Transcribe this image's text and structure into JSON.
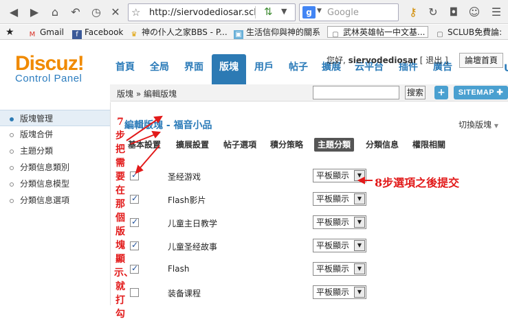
{
  "browser": {
    "url": "http://siervodediosar.sclub",
    "search_placeholder": "Google",
    "bookmarks": [
      {
        "label": "Gmail"
      },
      {
        "label": "Facebook"
      },
      {
        "label": "神の仆人之家BBS - P..."
      },
      {
        "label": "生活信仰與神的關系"
      },
      {
        "label": "武林英雄帖一中文基..."
      },
      {
        "label": "SCLUB免費論:"
      }
    ]
  },
  "header": {
    "logo_main": "Discuz!",
    "logo_sub": "Control Panel",
    "nav": [
      {
        "label": "首頁"
      },
      {
        "label": "全局"
      },
      {
        "label": "界面"
      },
      {
        "label": "版塊"
      },
      {
        "label": "用戶"
      },
      {
        "label": "帖子"
      },
      {
        "label": "擴展"
      },
      {
        "label": "云平台"
      },
      {
        "label": "插件"
      },
      {
        "label": "廣告"
      }
    ],
    "nav_cut_letter": "U",
    "user_greeting": "您好,",
    "username": "siervodediosar",
    "logout": "[ 退出 ]",
    "home_button": "論壇首頁"
  },
  "subbar": {
    "breadcrumb": "版塊 » 編輯版塊",
    "search_button": "搜索",
    "plus_label": "+",
    "sitemap_label": "SITEMAP"
  },
  "sidebar": {
    "items": [
      {
        "label": "版塊管理"
      },
      {
        "label": "版塊合併"
      },
      {
        "label": "主題分類"
      },
      {
        "label": "分類信息類別"
      },
      {
        "label": "分類信息模型"
      },
      {
        "label": "分類信息選項"
      }
    ]
  },
  "main": {
    "heading_prefix": "編輯版塊",
    "heading_sep": " - ",
    "heading_board": "福音小品",
    "switch_board": "切換版塊",
    "tabs": [
      {
        "label": "基本設置"
      },
      {
        "label": "擴展設置"
      },
      {
        "label": "帖子選項"
      },
      {
        "label": "積分策略"
      },
      {
        "label": "主題分類"
      },
      {
        "label": "分類信息"
      },
      {
        "label": "權限相關"
      }
    ],
    "rows": [
      {
        "label": "圣经游戏",
        "checked": true,
        "select": "平板顯示"
      },
      {
        "label": "Flash影片",
        "checked": true,
        "select": "平板顯示"
      },
      {
        "label": "儿童主日教学",
        "checked": true,
        "select": "平板顯示"
      },
      {
        "label": "儿童圣经故事",
        "checked": true,
        "select": "平板顯示"
      },
      {
        "label": "Flash",
        "checked": true,
        "select": "平板顯示"
      },
      {
        "label": "装备课程",
        "checked": false,
        "select": "平板顯示"
      }
    ]
  },
  "annotations": {
    "step7": "7步把需要在那個版塊顯示、就打勾",
    "step8": "8步選項之後提交",
    "color": "#e21a1a"
  }
}
